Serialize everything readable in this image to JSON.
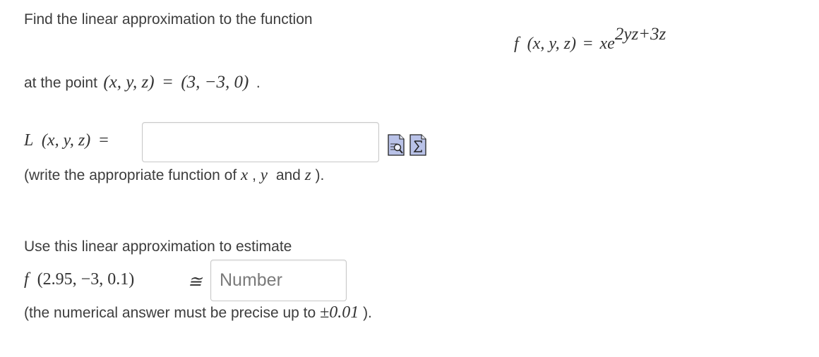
{
  "problem": {
    "intro": "Find the linear approximation to the function",
    "function_def": {
      "name": "f",
      "args": "(x, y, z)",
      "equals": "=",
      "base": "xe",
      "exponent": "2yz+3z"
    },
    "point_prefix": "at the point",
    "point_lhs": "(x, y, z)",
    "point_equals": "=",
    "point_value": "(3, −3, 0)",
    "point_suffix": "."
  },
  "linear_answer": {
    "label_name": "L",
    "label_args": "(x, y, z)",
    "label_equals": "=",
    "input_value": "",
    "input_placeholder": "",
    "hint_prefix": "(write the appropriate function of",
    "hint_x": "x",
    "hint_sep": ",",
    "hint_y": "y",
    "hint_and": "and",
    "hint_z": "z",
    "hint_suffix": ")."
  },
  "tools": {
    "preview_icon": "formula-preview-icon",
    "equation_editor_icon": "equation-editor-icon"
  },
  "estimate": {
    "intro": "Use this linear approximation to estimate",
    "lhs_name": "f",
    "lhs_args": "(2.95, −3, 0.1)",
    "approx_symbol": "≅",
    "input_placeholder": "Number",
    "input_value": "",
    "precision_prefix": "(the numerical answer must be precise up to",
    "precision_value": "±0.01",
    "precision_suffix": ")."
  }
}
